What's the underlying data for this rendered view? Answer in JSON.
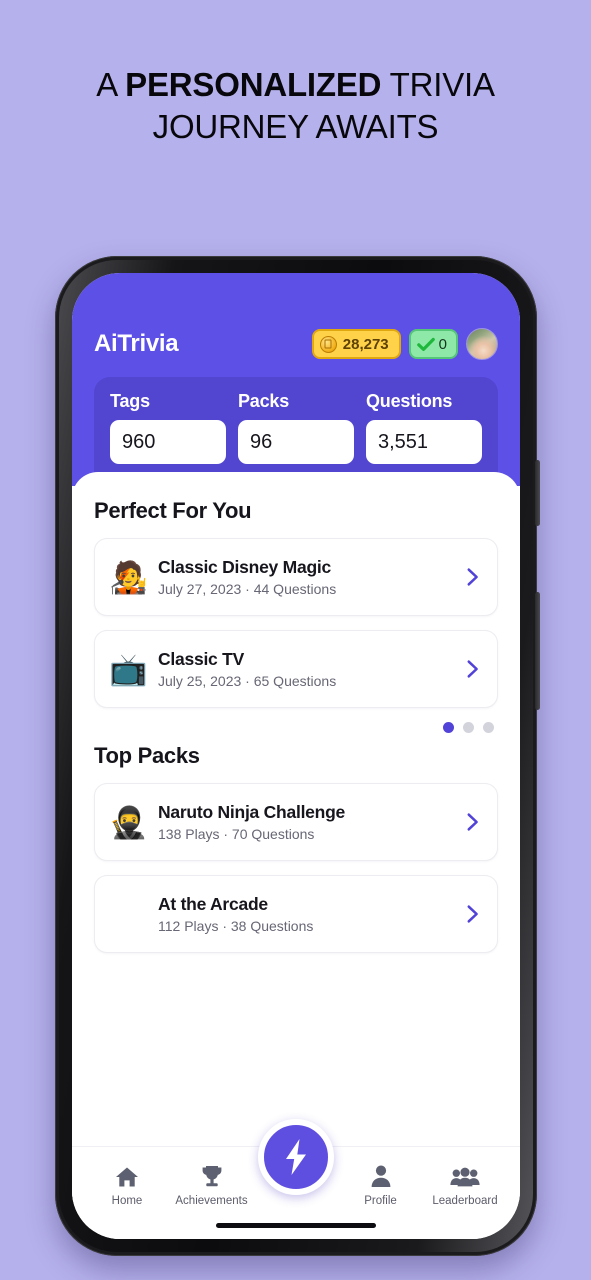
{
  "headline": {
    "prefix": "A ",
    "emphasis": "PERSONALIZED",
    "suffix": " TRIVIA",
    "line2": "JOURNEY AWAITS"
  },
  "app": {
    "brand": "AiTrivia",
    "coins": {
      "icon": "coin-icon",
      "value": "28,273"
    },
    "streak": {
      "icon": "check-icon",
      "value": "0"
    },
    "avatar_name": "user-avatar"
  },
  "stats": [
    {
      "label": "Tags",
      "value": "960"
    },
    {
      "label": "Packs",
      "value": "96"
    },
    {
      "label": "Questions",
      "value": "3,551"
    }
  ],
  "sections": [
    {
      "title": "Perfect For You",
      "cards": [
        {
          "emoji": "🧑‍🎤",
          "name": "Classic Disney Magic",
          "meta": "July 27, 2023 · 44 Questions"
        },
        {
          "emoji": "📺",
          "name": "Classic TV",
          "meta": "July 25, 2023 · 65 Questions"
        }
      ]
    },
    {
      "title": "Top Packs",
      "cards": [
        {
          "emoji": "🥷",
          "name": "Naruto Ninja Challenge",
          "meta": "138 Plays · 70 Questions"
        },
        {
          "emoji": "",
          "name": "At the Arcade",
          "meta": "112 Plays · 38 Questions"
        }
      ]
    }
  ],
  "pagination": {
    "count": 3,
    "active": 0
  },
  "nav": [
    {
      "label": "Home",
      "icon": "home-icon"
    },
    {
      "label": "Achievements",
      "icon": "trophy-icon"
    },
    {
      "label": "",
      "icon": "lightning-bolt-icon"
    },
    {
      "label": "Profile",
      "icon": "person-icon"
    },
    {
      "label": "Leaderboard",
      "icon": "people-group-icon"
    }
  ],
  "colors": {
    "background": "#b5b1ec",
    "header_purple": "#5d50e6",
    "stats_purple": "#5245cf",
    "accent": "#5f4fe0",
    "coin_yellow": "#ffd24a",
    "check_green": "#8ee9a8"
  }
}
